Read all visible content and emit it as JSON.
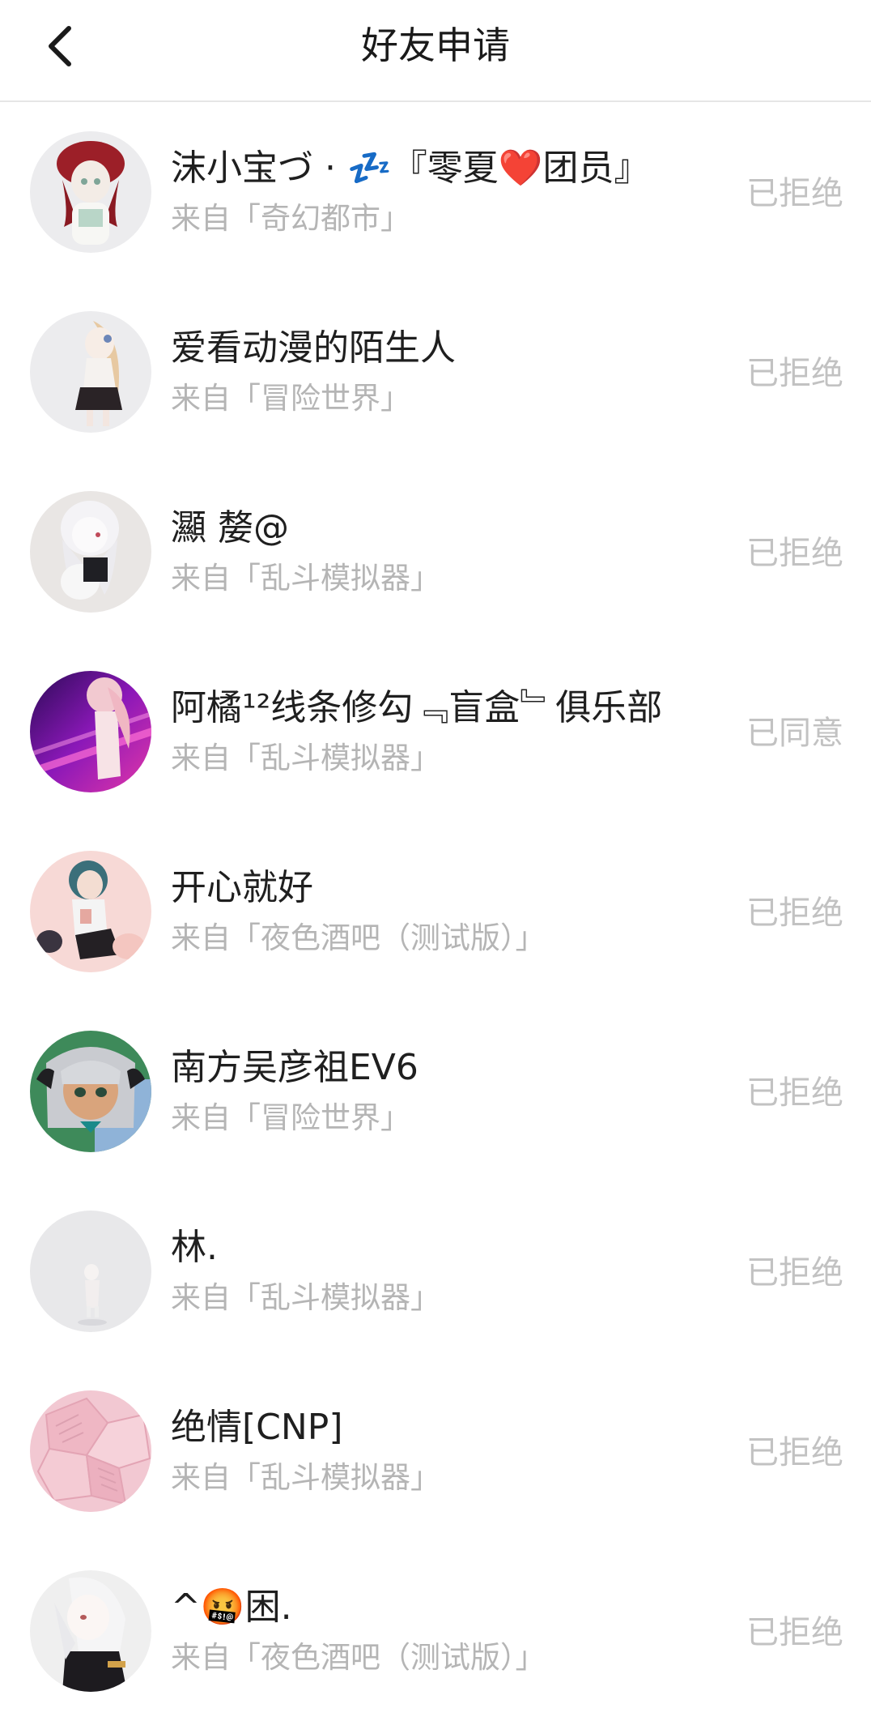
{
  "header": {
    "title": "好友申请",
    "back_icon": "chevron-left-icon"
  },
  "requests": [
    {
      "name": "沫小宝づ · 💤『零夏❤️团员』",
      "source": "来自「奇幻都市」",
      "status": "已拒绝"
    },
    {
      "name": "爱看动漫的陌生人",
      "source": "来自「冒险世界」",
      "status": "已拒绝"
    },
    {
      "name": "灦 嫠@",
      "source": "来自「乱斗模拟器」",
      "status": "已拒绝"
    },
    {
      "name": "阿橘¹²线条修勾﹃盲盒﹄俱乐部",
      "source": "来自「乱斗模拟器」",
      "status": "已同意"
    },
    {
      "name": "开心就好",
      "source": "来自「夜色酒吧（测试版）」",
      "status": "已拒绝"
    },
    {
      "name": "南方吴彦祖EV6",
      "source": "来自「冒险世界」",
      "status": "已拒绝"
    },
    {
      "name": "林.",
      "source": "来自「乱斗模拟器」",
      "status": "已拒绝"
    },
    {
      "name": "绝情[CNP]",
      "source": "来自「乱斗模拟器」",
      "status": "已拒绝"
    },
    {
      "name": "^🤬困.",
      "source": "来自「夜色酒吧（测试版）」",
      "status": "已拒绝"
    }
  ],
  "colors": {
    "title": "#1a1a1a",
    "name": "#1f1f1f",
    "secondary": "#b5b5b5",
    "status": "#c2c2c2",
    "divider": "#e6e6e6"
  }
}
